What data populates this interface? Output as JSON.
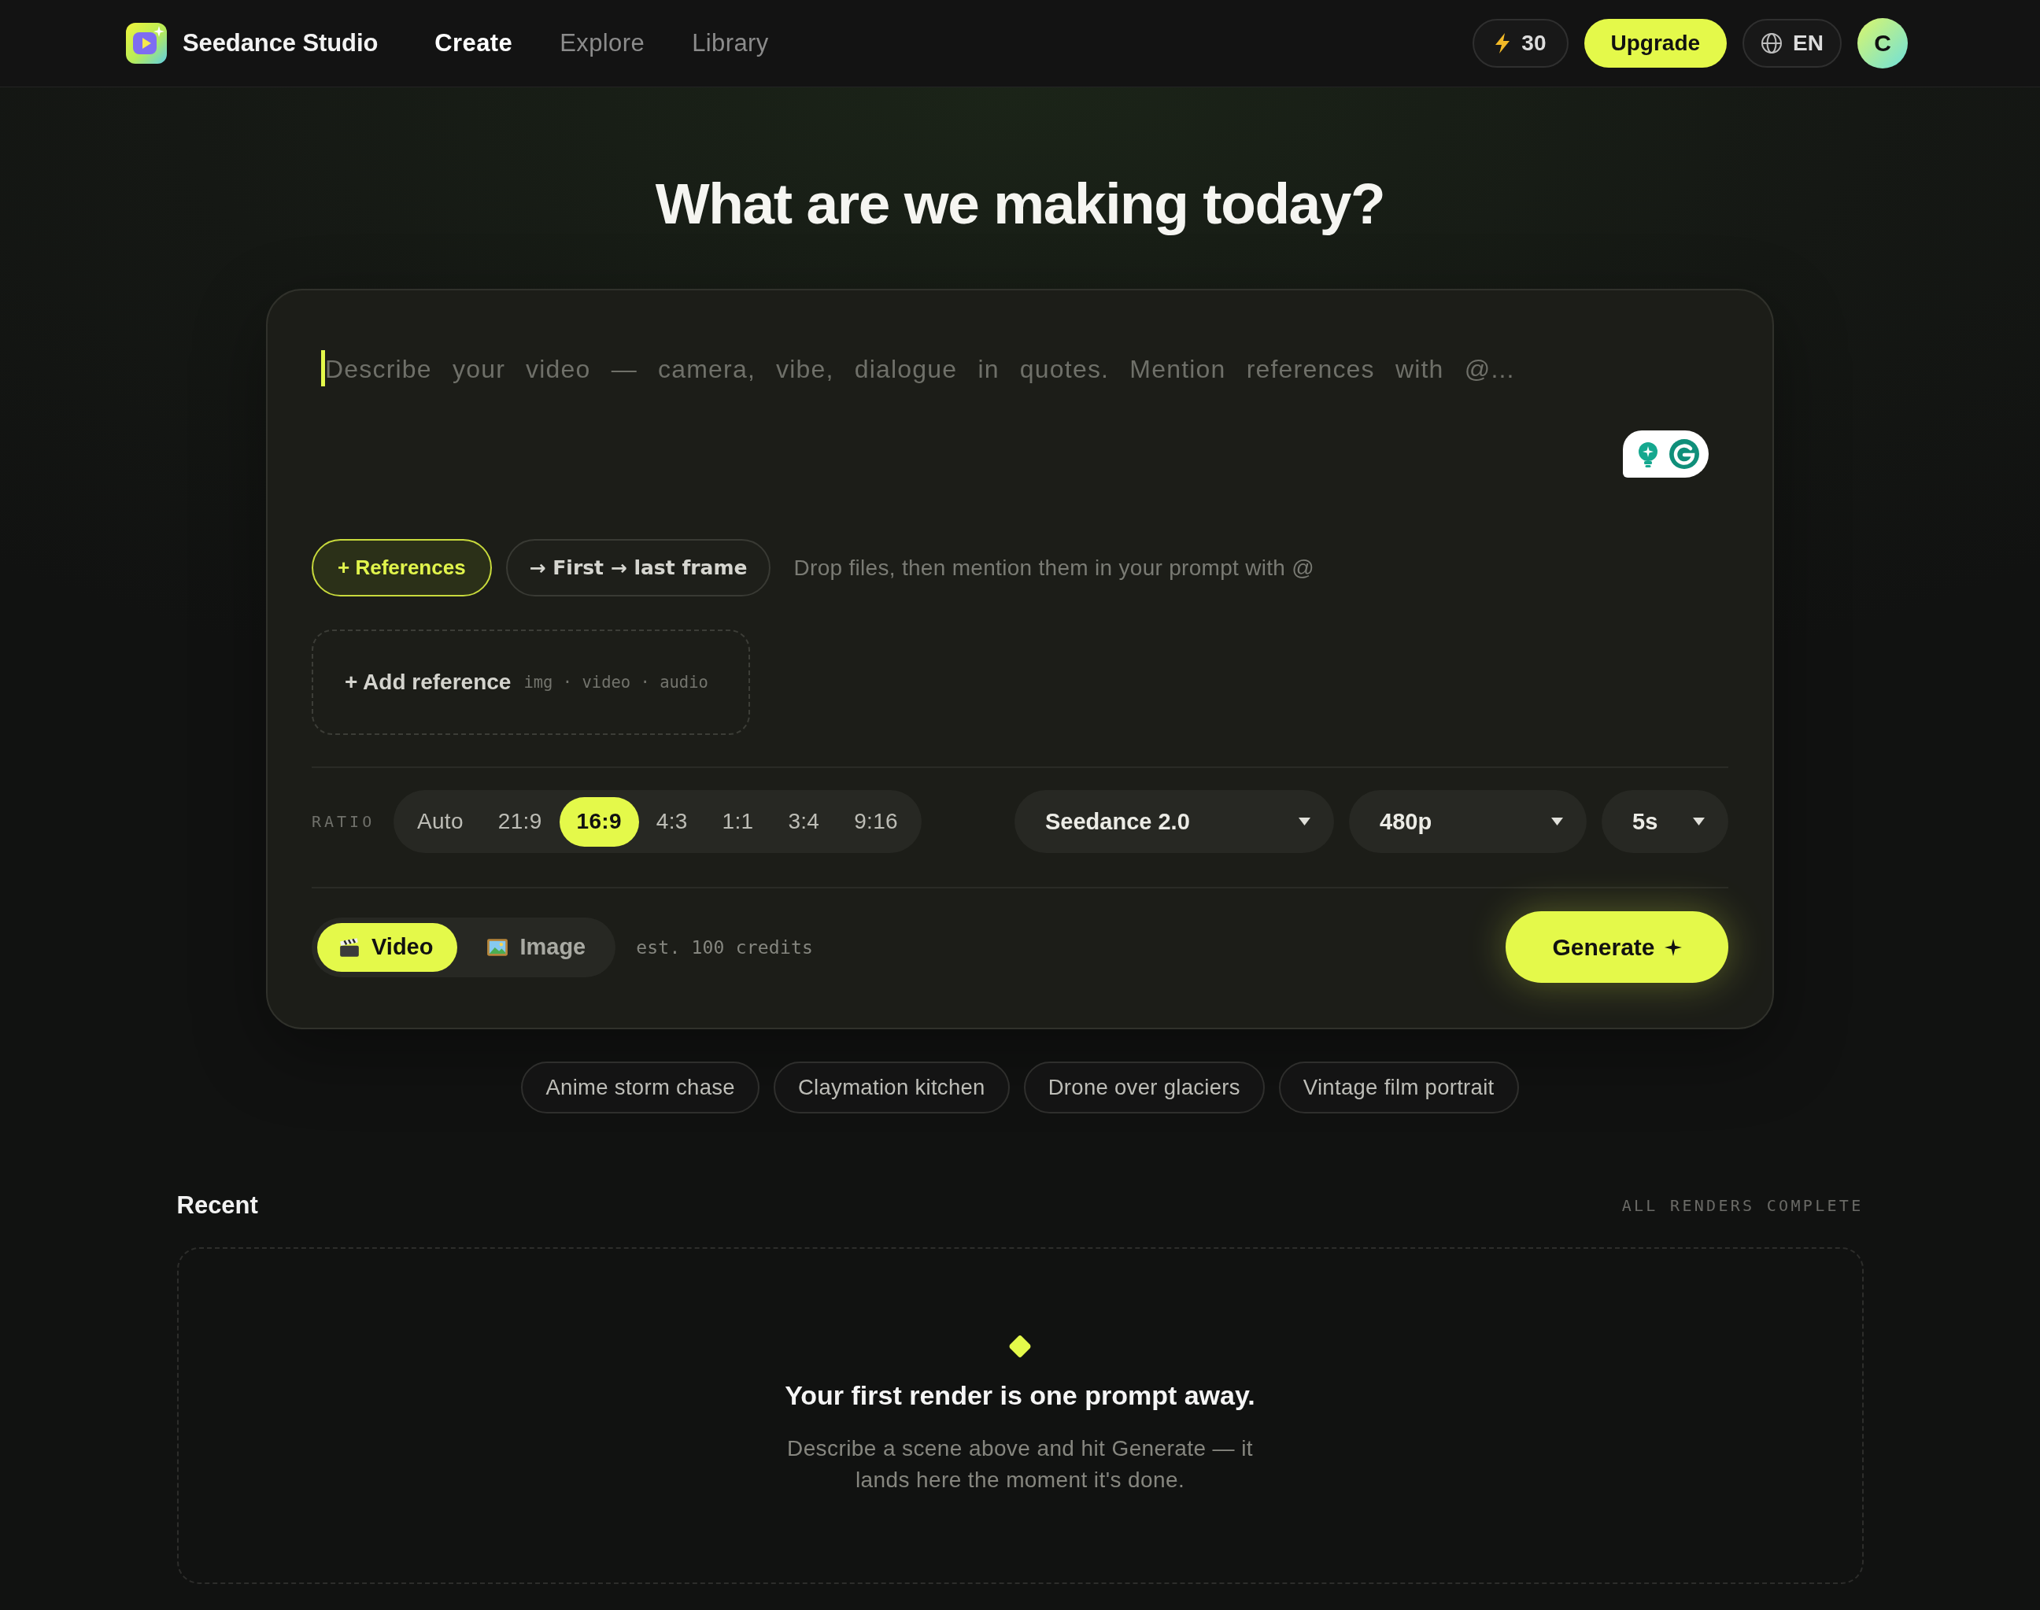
{
  "header": {
    "brand": "Seedance Studio",
    "nav": [
      {
        "label": "Create",
        "selected": true
      },
      {
        "label": "Explore",
        "selected": false
      },
      {
        "label": "Library",
        "selected": false
      }
    ],
    "credits": "30",
    "upgrade_button": "Upgrade",
    "language": "EN",
    "avatar_initial": "C"
  },
  "heading": "What are we making today?",
  "composer": {
    "prompt": {
      "placeholder": "Describe your video — camera, vibe, dialogue in quotes. Mention references with @..."
    },
    "reference_modes": [
      {
        "label": "+ References",
        "selected": true
      },
      {
        "label": "→ First → last frame",
        "selected": false
      }
    ],
    "reference_hint": "Drop files, then mention them in your prompt with @",
    "add_reference": {
      "label": "+ Add reference",
      "types": "img · video · audio"
    },
    "ratio": {
      "label": "RATIO",
      "options": [
        {
          "label": "Auto",
          "selected": false
        },
        {
          "label": "21:9",
          "selected": false
        },
        {
          "label": "16:9",
          "selected": true
        },
        {
          "label": "4:3",
          "selected": false
        },
        {
          "label": "1:1",
          "selected": false
        },
        {
          "label": "3:4",
          "selected": false
        },
        {
          "label": "9:16",
          "selected": false
        }
      ]
    },
    "dropdowns": [
      {
        "value": "Seedance 2.0"
      },
      {
        "value": "480p"
      },
      {
        "value": "5s"
      }
    ],
    "output_modes": [
      {
        "label": "Video",
        "selected": true
      },
      {
        "label": "Image",
        "selected": false
      }
    ],
    "estimate": "est. 100 credits",
    "generate_button": "Generate"
  },
  "suggestions": [
    "Anime storm chase",
    "Claymation kitchen",
    "Drone over glaciers",
    "Vintage film portrait"
  ],
  "recent": {
    "title": "Recent",
    "status": "ALL RENDERS COMPLETE",
    "empty_title": "Your first render is one prompt away.",
    "empty_text": "Describe a scene above and hit Generate — it lands here the moment it's done."
  }
}
